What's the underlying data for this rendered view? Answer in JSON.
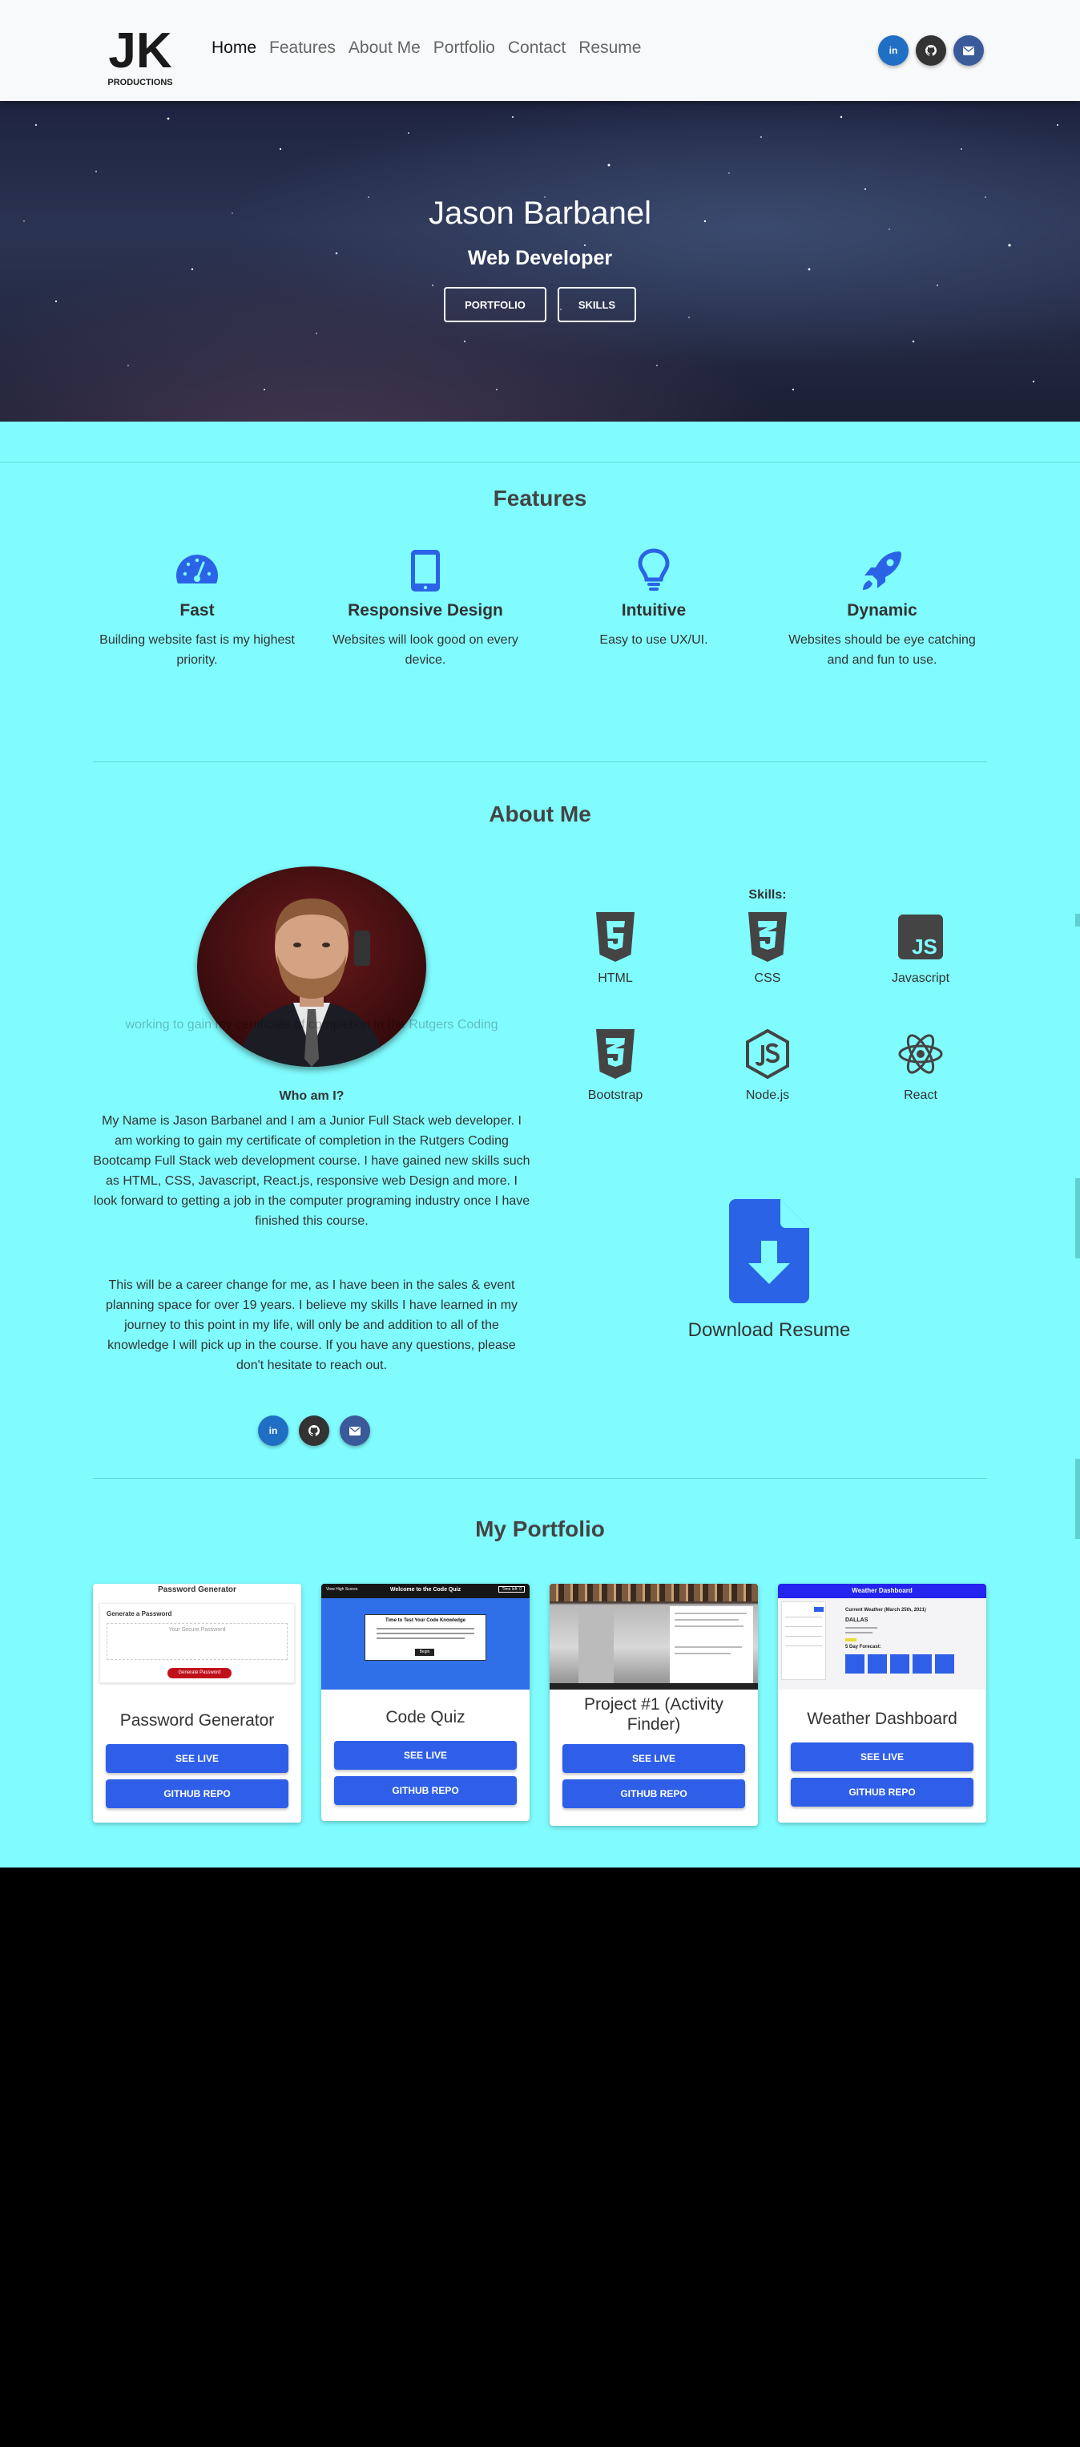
{
  "nav": {
    "logo_text": "JK",
    "logo_sub": "PRODUCTIONS",
    "links": [
      "Home",
      "Features",
      "About Me",
      "Portfolio",
      "Contact",
      "Resume"
    ],
    "social": {
      "linkedin": "in",
      "github": "github-icon",
      "email": "envelope-icon"
    }
  },
  "hero": {
    "title": "Jason Barbanel",
    "subtitle": "Web Developer",
    "btn_portfolio": "PORTFOLIO",
    "btn_skills": "SKILLS"
  },
  "features": {
    "title": "Features",
    "items": [
      {
        "icon": "speedometer-icon",
        "title": "Fast",
        "text": "Building website fast is my highest priority."
      },
      {
        "icon": "tablet-icon",
        "title": "Responsive Design",
        "text": "Websites will look good on every device."
      },
      {
        "icon": "lightbulb-icon",
        "title": "Intuitive",
        "text": "Easy to use UX/UI."
      },
      {
        "icon": "rocket-icon",
        "title": "Dynamic",
        "text": "Websites should be eye catching and and fun to use."
      }
    ]
  },
  "about": {
    "title": "About Me",
    "who": "Who am I?",
    "para1": "My Name is Jason Barbanel and I am a Junior Full Stack web developer. I am working to gain my certificate of completion in the Rutgers Coding Bootcamp Full Stack web development course. I have gained new skills such as HTML, CSS, Javascript, React.js, responsive web Design and more. I look forward to getting a job in the computer programing industry once I have finished this course.",
    "para2": "This will be a career change for me, as I have been in the sales & event planning space for over 19 years. I believe my skills I have learned in my journey to this point in my life, will only be and addition to all of the knowledge I will pick up in the course. If you have any questions, please don't hesitate to reach out.",
    "skills_label": "Skills:",
    "skills": [
      "HTML",
      "CSS",
      "Javascript",
      "Bootstrap",
      "Node.js",
      "React"
    ],
    "resume_label": "Download Resume"
  },
  "portfolio": {
    "title": "My Portfolio",
    "cards": [
      {
        "title": "Password Generator",
        "live": "SEE LIVE",
        "repo": "GITHUB REPO",
        "thumb": {
          "header": "Password Generator",
          "sub": "Generate a Password",
          "placeholder": "Your Secure Password",
          "button": "Generate Password"
        }
      },
      {
        "title": "Code Quiz",
        "live": "SEE LIVE",
        "repo": "GITHUB REPO",
        "thumb": {
          "header": "Welcome to the Code Quiz",
          "left": "View High Scores",
          "right": "Time left: 0",
          "box_title": "Time to Test Your Code Knowledge",
          "button": "Begin"
        }
      },
      {
        "title": "Project #1 (Activity Finder)",
        "live": "SEE LIVE",
        "repo": "GITHUB REPO",
        "thumb": {}
      },
      {
        "title": "Weather Dashboard",
        "live": "SEE LIVE",
        "repo": "GITHUB REPO",
        "thumb": {
          "header": "Weather Dashboard",
          "current": "Current Weather (March 25th, 2021)",
          "city": "DALLAS",
          "forecast": "5 Day Forecast:"
        }
      }
    ]
  },
  "colors": {
    "accent": "#2f5fe8",
    "section_bg": "#80fcfe",
    "icon_blue": "#2b63e6",
    "icon_dark": "#444444"
  }
}
